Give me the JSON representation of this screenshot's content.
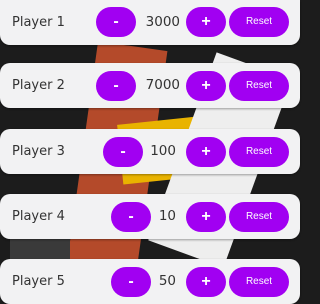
{
  "players": [
    {
      "name": "Player 1",
      "score": "3000"
    },
    {
      "name": "Player 2",
      "score": "7000"
    },
    {
      "name": "Player 3",
      "score": "100"
    },
    {
      "name": "Player 4",
      "score": "10"
    },
    {
      "name": "Player 5",
      "score": "50"
    }
  ],
  "buttons": {
    "minus": "-",
    "plus": "+",
    "reset": "Reset"
  },
  "colors": {
    "accent": "#a100f2",
    "card": "#f2f2f3"
  },
  "background": {
    "description_icon": "playing-cards-icon"
  }
}
